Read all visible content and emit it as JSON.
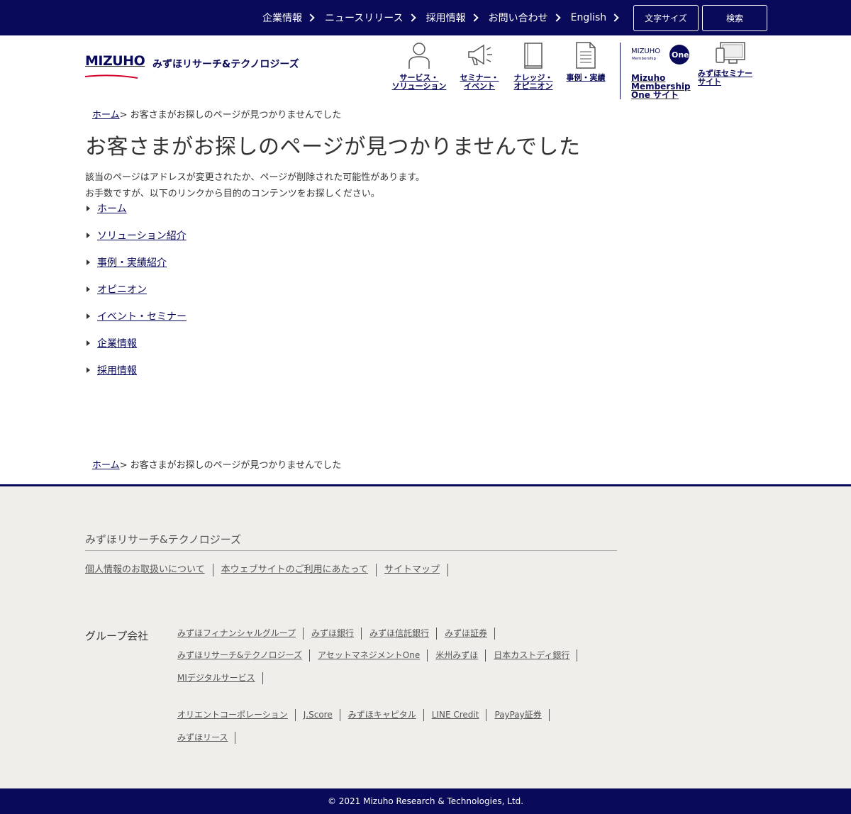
{
  "topnav": {
    "items": [
      {
        "label": "企業情報"
      },
      {
        "label": "ニュースリリース"
      },
      {
        "label": "採用情報"
      },
      {
        "label": "お問い合わせ"
      },
      {
        "label": "English"
      }
    ],
    "font_size_label": "文字サイズ",
    "search_label": "検索"
  },
  "header": {
    "logo_text": "MIZUHO",
    "company_name": "みずほリサーチ&テクノロジーズ",
    "nav": [
      {
        "line1": "サービス・",
        "line2": "ソリューション",
        "icon": "person-icon"
      },
      {
        "line1": "セミナー・",
        "line2": "イベント",
        "icon": "megaphone-icon"
      },
      {
        "line1": "ナレッジ・",
        "line2": "オピニオン",
        "icon": "book-icon"
      },
      {
        "line1": "事例・実績",
        "line2": "",
        "icon": "document-icon"
      }
    ],
    "membership": {
      "logo_line1": "MIZUHO",
      "logo_line2": "Membership",
      "logo_one": "One",
      "label_line1": "Mizuho",
      "label_line2": "Membership",
      "label_line3": "One サイト"
    },
    "seminar_site": {
      "line1": "みずほセミナー",
      "line2": "サイト",
      "icon": "monitor-icon"
    }
  },
  "breadcrumb": {
    "home": "ホーム",
    "current": "> お客さまがお探しのページが見つかりませんでした"
  },
  "main": {
    "title": "お客さまがお探しのページが見つかりませんでした",
    "desc1": "該当のページはアドレスが変更されたか、ページが削除された可能性があります。",
    "desc2": "お手数ですが、以下のリンクから目的のコンテンツをお探しください。",
    "links": [
      "ホーム",
      "ソリューション紹介",
      "事例・実績紹介",
      "オピニオン",
      "イベント・セミナー",
      "企業情報",
      "採用情報"
    ]
  },
  "footer": {
    "company": "みずほリサーチ&テクノロジーズ",
    "links": [
      "個人情報のお取扱いについて",
      "本ウェブサイトのご利用にあたって",
      "サイトマップ"
    ],
    "group_label": "グループ会社",
    "group_rows": [
      [
        "みずほフィナンシャルグループ",
        "みずほ銀行",
        "みずほ信託銀行",
        "みずほ証券"
      ],
      [
        "みずほリサーチ&テクノロジーズ",
        "アセットマネジメントOne",
        "米州みずほ",
        "日本カストディ銀行"
      ],
      [
        "MIデジタルサービス"
      ],
      [
        "オリエントコーポレーション",
        "J.Score",
        "みずほキャピタル",
        "LINE Credit",
        "PayPay証券"
      ],
      [
        "みずほリース"
      ]
    ],
    "copyright": "© 2021 Mizuho Research & Technologies, Ltd."
  },
  "colors": {
    "brand_navy": "#0a0a5a",
    "brand_red": "#d2002a",
    "footer_bg": "#efeeeb"
  }
}
